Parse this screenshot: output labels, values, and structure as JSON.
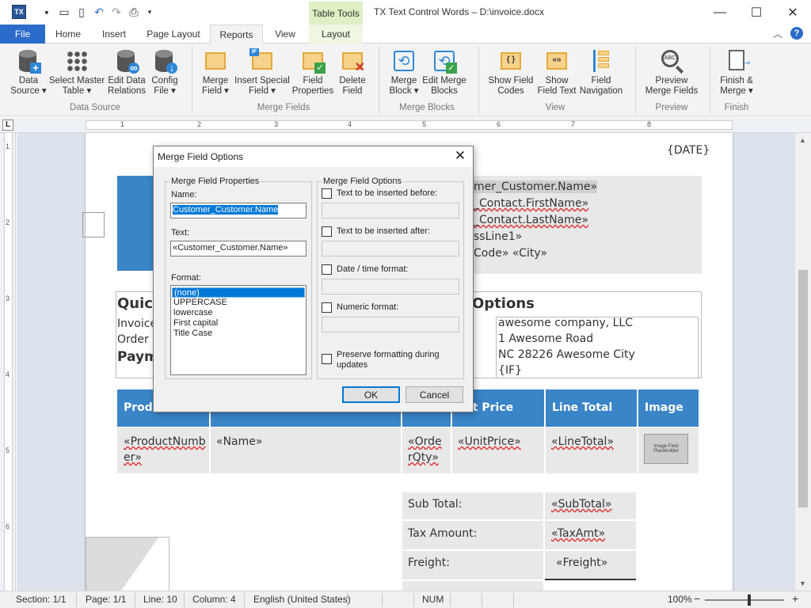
{
  "titlebar": {
    "title": "TX Text Control Words – D:\\invoice.docx",
    "context_tab": "Table Tools",
    "logo_text": "TX"
  },
  "tabs": [
    "File",
    "Home",
    "Insert",
    "Page Layout",
    "Reports",
    "View",
    "Layout"
  ],
  "ribbon": {
    "groups": [
      {
        "label": "Data Source",
        "buttons": [
          {
            "label1": "Data",
            "label2": "Source ▾"
          },
          {
            "label1": "Select Master",
            "label2": "Table ▾"
          },
          {
            "label1": "Edit Data",
            "label2": "Relations"
          },
          {
            "label1": "Config",
            "label2": "File ▾"
          }
        ]
      },
      {
        "label": "Merge Fields",
        "buttons": [
          {
            "label1": "Merge",
            "label2": "Field ▾"
          },
          {
            "label1": "Insert Special",
            "label2": "Field ▾"
          },
          {
            "label1": "Field",
            "label2": "Properties"
          },
          {
            "label1": "Delete",
            "label2": "Field"
          }
        ]
      },
      {
        "label": "Merge Blocks",
        "buttons": [
          {
            "label1": "Merge",
            "label2": "Block ▾"
          },
          {
            "label1": "Edit Merge",
            "label2": "Blocks"
          }
        ]
      },
      {
        "label": "View",
        "buttons": [
          {
            "label1": "Show Field",
            "label2": "Codes"
          },
          {
            "label1": "Show",
            "label2": "Field Text"
          },
          {
            "label1": "Field",
            "label2": "Navigation"
          }
        ]
      },
      {
        "label": "Preview",
        "buttons": [
          {
            "label1": "Preview",
            "label2": "Merge Fields"
          }
        ]
      },
      {
        "label": "Finish",
        "buttons": [
          {
            "label1": "Finish &",
            "label2": "Merge ▾"
          }
        ]
      }
    ]
  },
  "ruler": {
    "numbers": [
      "1",
      "2",
      "3",
      "4",
      "5",
      "6",
      "7",
      "8"
    ],
    "corner": "L"
  },
  "vruler": {
    "numbers": [
      "1",
      "2",
      "3",
      "4",
      "5",
      "6"
    ]
  },
  "document": {
    "date_field": "{DATE}",
    "address": [
      "mer_Customer.Name»",
      "_Contact.FirstName»",
      "_Contact.LastName»",
      "ssLine1»",
      "Code» «City»"
    ],
    "quick_heading": "Quick",
    "options_heading": "Options",
    "invoice_label": "Invoice",
    "order_label": "Order D",
    "payment_label": "Paym",
    "company": [
      "awesome company, LLC",
      "1 Awesome Road",
      "NC 28226 Awesome City",
      "{IF}"
    ],
    "table_headers": [
      "Produ",
      "",
      "",
      "it Price",
      "Line Total",
      "Image"
    ],
    "row": {
      "product": [
        "«ProductNumb",
        "er»"
      ],
      "name": "«Name»",
      "qty": [
        "«Orde",
        "rQty»"
      ],
      "unit_price": "«UnitPrice»",
      "line_total": "«LineTotal»",
      "image": "Image Field Placeholder"
    },
    "totals": [
      {
        "label": "Sub Total:",
        "value": "«SubTotal»"
      },
      {
        "label": "Tax Amount:",
        "value": "«TaxAmt»"
      },
      {
        "label": "Freight:",
        "value": "«Freight»"
      }
    ]
  },
  "dialog": {
    "title": "Merge Field Options",
    "left_group": "Merge Field Properties",
    "name_label": "Name:",
    "name_value": "Customer_Customer.Name",
    "text_label": "Text:",
    "text_value": "«Customer_Customer.Name»",
    "format_label": "Format:",
    "formats": [
      "(none)",
      "UPPERCASE",
      "lowercase",
      "First capital",
      "Title Case"
    ],
    "right_group": "Merge Field Options",
    "opt_before": "Text to be inserted before:",
    "opt_after": "Text to be inserted after:",
    "opt_date": "Date / time format:",
    "opt_numeric": "Numeric format:",
    "opt_preserve1": "Preserve formatting during",
    "opt_preserve2": "updates",
    "ok": "OK",
    "cancel": "Cancel"
  },
  "status": {
    "section": "Section: 1/1",
    "page": "Page: 1/1",
    "line": "Line: 10",
    "column": "Column: 4",
    "language": "English (United States)",
    "num": "NUM",
    "zoom": "100%"
  }
}
